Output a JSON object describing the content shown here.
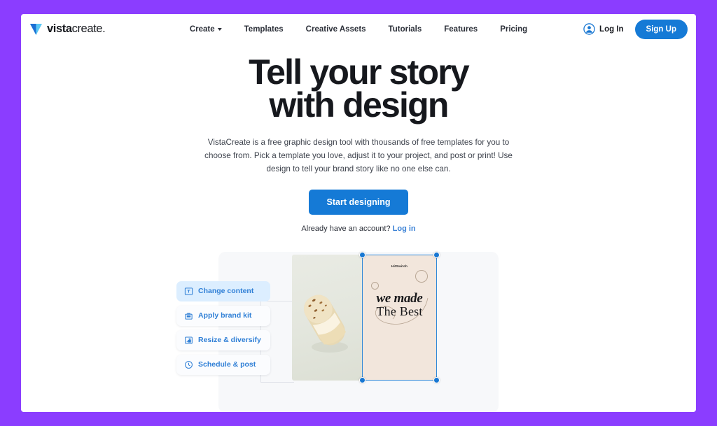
{
  "brand": {
    "name_bold": "vista",
    "name_light": "create.",
    "logo_icon": "vistacreate-triangle-logo"
  },
  "nav": {
    "items": [
      {
        "label": "Create",
        "has_dropdown": true
      },
      {
        "label": "Templates",
        "has_dropdown": false
      },
      {
        "label": "Creative Assets",
        "has_dropdown": false
      },
      {
        "label": "Tutorials",
        "has_dropdown": false
      },
      {
        "label": "Features",
        "has_dropdown": false
      },
      {
        "label": "Pricing",
        "has_dropdown": false
      }
    ]
  },
  "header_right": {
    "login_label": "Log In",
    "login_icon": "user-avatar-icon",
    "signup_label": "Sign Up"
  },
  "hero": {
    "headline_line1": "Tell your story",
    "headline_line2": "with design",
    "subtext": "VistaCreate is a free graphic design tool with thousands of free templates for you to choose from. Pick a template you love, adjust it to your project, and post or print! Use design to tell your brand story like no one else can.",
    "cta_label": "Start designing",
    "account_prompt": "Already have an account?",
    "account_link": "Log in"
  },
  "illustration": {
    "chips": [
      {
        "label": "Change content",
        "icon": "text-box-icon",
        "active": true
      },
      {
        "label": "Apply brand kit",
        "icon": "briefcase-icon",
        "active": false
      },
      {
        "label": "Resize & diversify",
        "icon": "resize-icon",
        "active": false
      },
      {
        "label": "Schedule & post",
        "icon": "clock-icon",
        "active": false
      }
    ],
    "design": {
      "brand_label": "HitSwitch",
      "word_line1": "we made",
      "word_line2": "The Best",
      "photo_alt": "eclair-pastry-photo"
    }
  },
  "colors": {
    "page_border": "#8b3dff",
    "accent_blue": "#157ad6",
    "chip_text": "#2f7fd6",
    "chip_active_bg": "#dceeff",
    "selection": "#2f88d8",
    "design_panel_bg": "#f2e6dc"
  }
}
